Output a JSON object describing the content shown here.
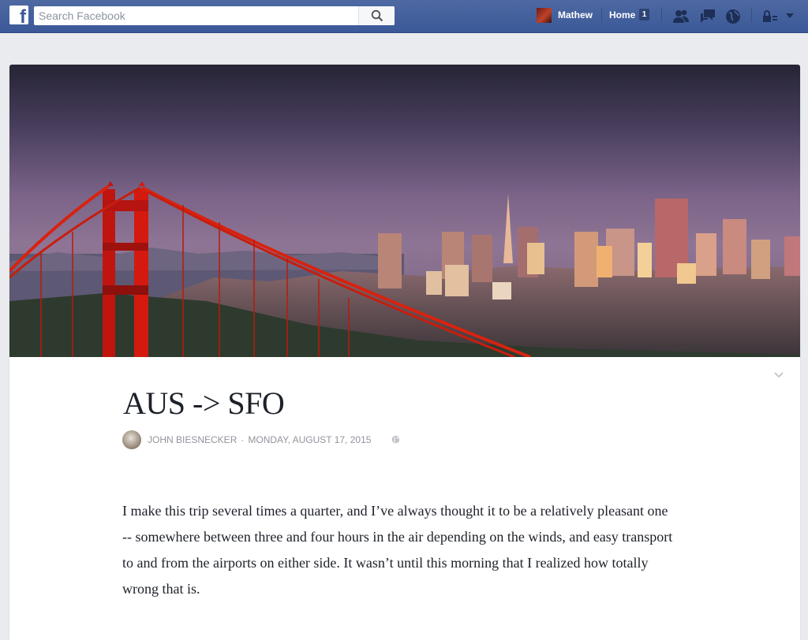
{
  "topbar": {
    "logo_letter": "f",
    "search_placeholder": "Search Facebook",
    "search_value": "",
    "user_name": "Mathew",
    "home_label": "Home",
    "home_count": "1",
    "colors": {
      "bar": "#3b5998",
      "badge": "#2d4473"
    }
  },
  "icons": [
    "facebook-logo-icon",
    "search-icon",
    "friend-requests-icon",
    "messages-icon",
    "notifications-globe-icon",
    "privacy-lock-icon",
    "account-menu-caret-icon",
    "chevron-down-icon",
    "globe-icon"
  ],
  "note": {
    "title": "AUS -> SFO",
    "author": "John Biesnecker",
    "separator": "·",
    "date": "Monday, August 17, 2015",
    "body": "I make this trip several times a quarter, and I’ve always thought it to be a relatively pleasant one -- somewhere between three and four hours in the air depending on the winds, and easy transport to and from the airports on either side. It wasn’t until this morning that I realized how totally wrong that is."
  }
}
